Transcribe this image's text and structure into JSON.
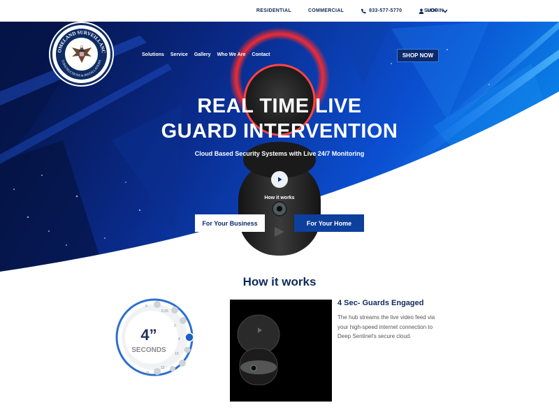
{
  "topnav": {
    "residential": "RESIDENTIAL",
    "commercial": "COMMERCIAL",
    "phone": "833-577-5770",
    "login": "LOGIN",
    "shop": "SHOP"
  },
  "logo": {
    "top_text": "HOMELAND SURVEILLANCE",
    "bottom_text": "CONSTRUCTIONS & INSTALLATIONS"
  },
  "mainnav": [
    "Solutions",
    "Service",
    "Gallery",
    "Who We Are",
    "Contact"
  ],
  "shop_now": "SHOP NOW",
  "hero": {
    "title_line1": "REAL TIME LIVE",
    "title_line2": "GUARD INTERVENTION",
    "subtitle": "Cloud Based Security Systems with Live 24/7 Monitoring",
    "play_label": "How it works",
    "btn_business": "For Your Business",
    "btn_home": "For Your Home"
  },
  "how": {
    "title": "How it works",
    "dial_value": "4”",
    "dial_unit": "SECONDS",
    "dial_ticks": [
      "0",
      "0.25",
      "2",
      "4",
      "10",
      "13",
      "22"
    ],
    "step_title": "4 Sec- Guards Engaged",
    "step_text": "The hub streams the live video feed via your high-speed internet connection to Deep Sentinel's secure cloud."
  },
  "colors": {
    "navy": "#0f2a5c",
    "accent_blue": "#0d3f9c",
    "glow_red": "#ff2a2a"
  }
}
